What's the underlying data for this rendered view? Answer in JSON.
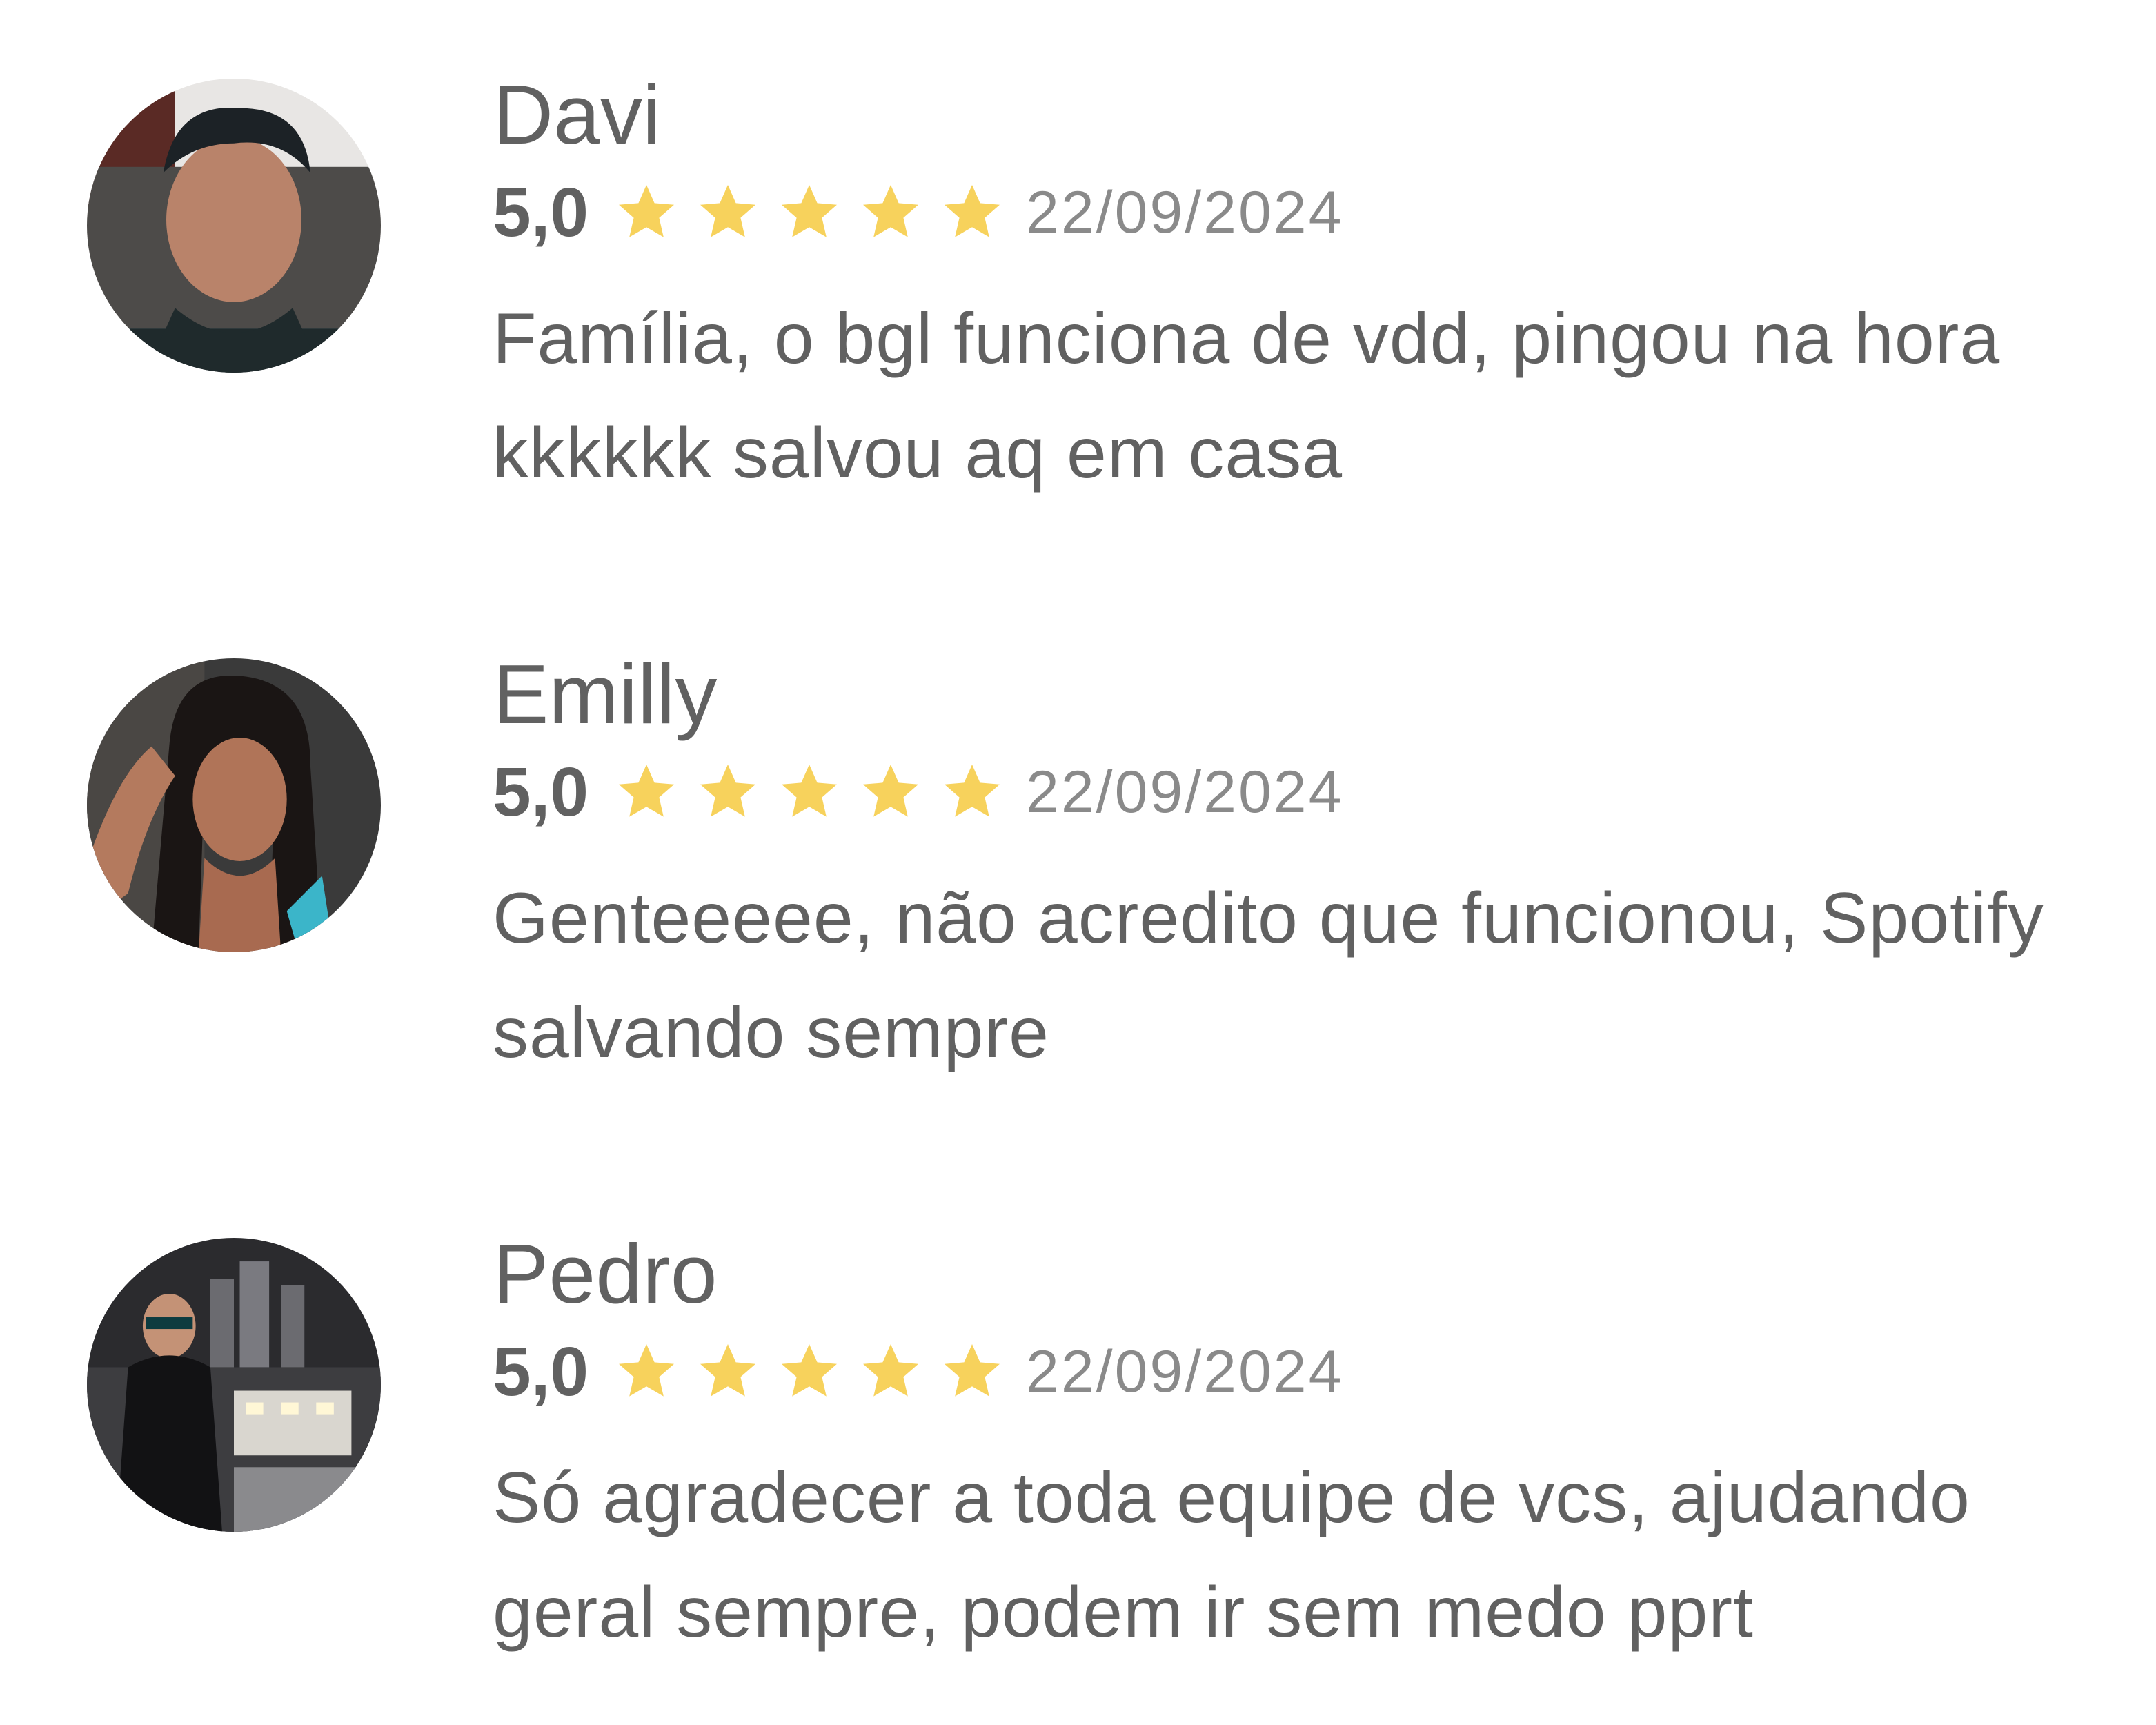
{
  "reviews": [
    {
      "name": "Davi",
      "score": "5,0",
      "stars": 5,
      "date": "22/09/2024",
      "text": "Família, o bgl funciona de vdd, pingou na hora kkkkkk salvou aq em casa",
      "avatar_icon": "user-photo-avatar"
    },
    {
      "name": "Emilly",
      "score": "5,0",
      "stars": 5,
      "date": "22/09/2024",
      "text": "Genteeeee, não acredito que funcionou, Spotify salvando sempre",
      "avatar_icon": "user-photo-avatar"
    },
    {
      "name": "Pedro",
      "score": "5,0",
      "stars": 5,
      "date": "22/09/2024",
      "text": "Só agradecer a toda equipe de vcs, ajudando geral sempre, podem ir sem medo pprt",
      "avatar_icon": "user-photo-avatar"
    }
  ],
  "colors": {
    "star": "#f7d25c",
    "text": "#616161",
    "date": "#8a8a8a",
    "background": "#ffffff"
  }
}
